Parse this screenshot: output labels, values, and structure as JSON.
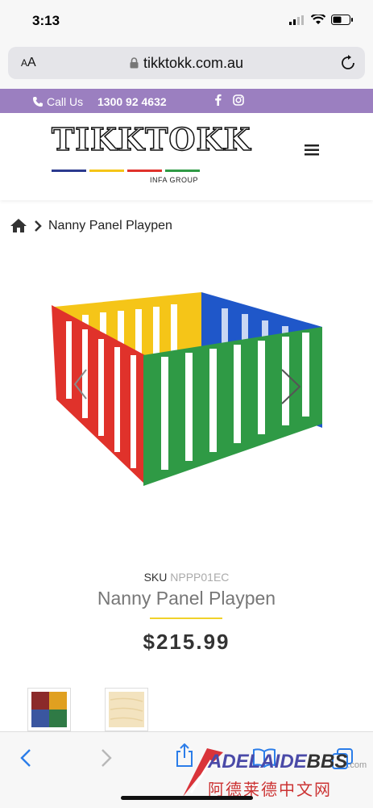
{
  "status_bar": {
    "time": "3:13"
  },
  "browser": {
    "aa_small": "A",
    "aa_large": "A",
    "url": "tikktokk.com.au"
  },
  "topbar": {
    "call_label": "Call Us",
    "phone": "1300 92 4632"
  },
  "logo": {
    "main_text": "TIKKTOKK",
    "sub_text": "INFA GROUP"
  },
  "breadcrumb": {
    "current": "Nanny Panel Playpen"
  },
  "product": {
    "sku_label": "SKU",
    "sku_value": "NPPP01EC",
    "title": "Nanny Panel Playpen",
    "price": "$215.99"
  },
  "watermark": {
    "brand_a": "ADELAIDE",
    "brand_b": "BBS",
    "dotcom": ".com",
    "chinese": "阿德莱德中文网"
  },
  "colors": {
    "purple": "#9b7fc0",
    "accent_yellow": "#f0d12a",
    "ios_blue": "#2b7de9",
    "panel_red": "#e0322b",
    "panel_yellow": "#f5c518",
    "panel_green": "#2f9a45",
    "panel_blue": "#1f57c9"
  },
  "icons": [
    "signal-icon",
    "wifi-icon",
    "battery-icon",
    "lock-icon",
    "reload-icon",
    "phone-icon",
    "facebook-icon",
    "instagram-icon",
    "menu-icon",
    "home-icon",
    "chevron-right-icon",
    "back-icon",
    "forward-icon",
    "share-icon",
    "bookmarks-icon",
    "tabs-icon"
  ]
}
